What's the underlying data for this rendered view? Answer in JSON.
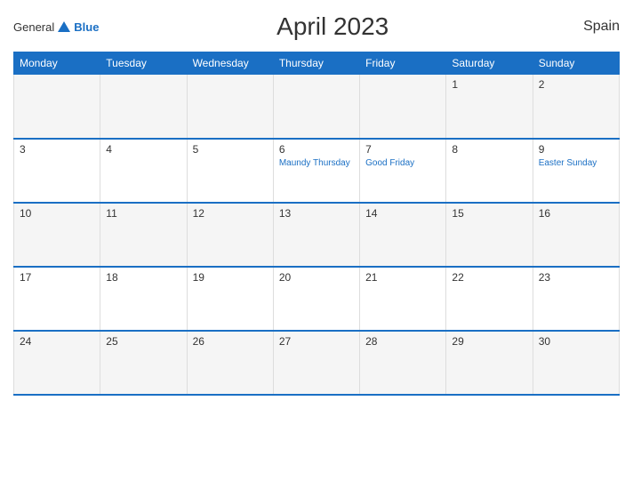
{
  "header": {
    "logo": {
      "general": "General",
      "blue": "Blue"
    },
    "title": "April 2023",
    "country": "Spain"
  },
  "calendar": {
    "days_of_week": [
      "Monday",
      "Tuesday",
      "Wednesday",
      "Thursday",
      "Friday",
      "Saturday",
      "Sunday"
    ],
    "weeks": [
      [
        {
          "date": "",
          "events": []
        },
        {
          "date": "",
          "events": []
        },
        {
          "date": "",
          "events": []
        },
        {
          "date": "",
          "events": []
        },
        {
          "date": "",
          "events": []
        },
        {
          "date": "1",
          "events": []
        },
        {
          "date": "2",
          "events": []
        }
      ],
      [
        {
          "date": "3",
          "events": []
        },
        {
          "date": "4",
          "events": []
        },
        {
          "date": "5",
          "events": []
        },
        {
          "date": "6",
          "events": [
            "Maundy Thursday"
          ]
        },
        {
          "date": "7",
          "events": [
            "Good Friday"
          ]
        },
        {
          "date": "8",
          "events": []
        },
        {
          "date": "9",
          "events": [
            "Easter Sunday"
          ]
        }
      ],
      [
        {
          "date": "10",
          "events": []
        },
        {
          "date": "11",
          "events": []
        },
        {
          "date": "12",
          "events": []
        },
        {
          "date": "13",
          "events": []
        },
        {
          "date": "14",
          "events": []
        },
        {
          "date": "15",
          "events": []
        },
        {
          "date": "16",
          "events": []
        }
      ],
      [
        {
          "date": "17",
          "events": []
        },
        {
          "date": "18",
          "events": []
        },
        {
          "date": "19",
          "events": []
        },
        {
          "date": "20",
          "events": []
        },
        {
          "date": "21",
          "events": []
        },
        {
          "date": "22",
          "events": []
        },
        {
          "date": "23",
          "events": []
        }
      ],
      [
        {
          "date": "24",
          "events": []
        },
        {
          "date": "25",
          "events": []
        },
        {
          "date": "26",
          "events": []
        },
        {
          "date": "27",
          "events": []
        },
        {
          "date": "28",
          "events": []
        },
        {
          "date": "29",
          "events": []
        },
        {
          "date": "30",
          "events": []
        }
      ]
    ]
  }
}
